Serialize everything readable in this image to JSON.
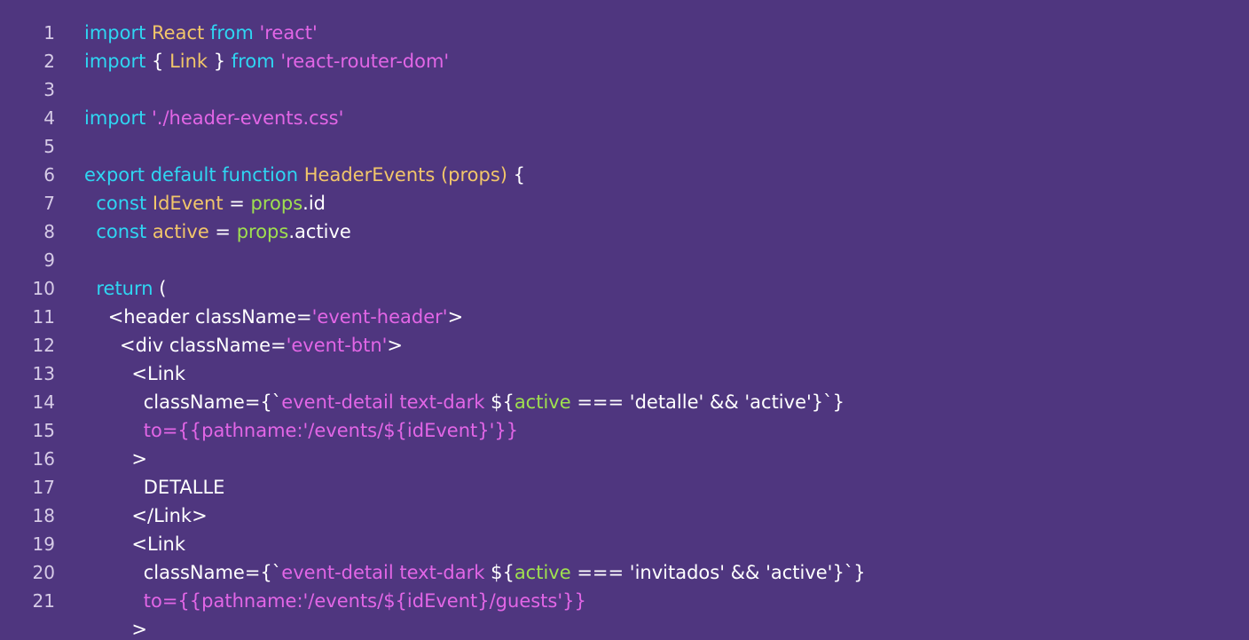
{
  "theme": {
    "background": "#4f367f",
    "keyword": "#2fd6f2",
    "identifier": "#f2c66a",
    "string": "#e266e6",
    "props": "#9fe04f",
    "plain": "#ffffff",
    "line_number": "#d6cbe6"
  },
  "lines": [
    {
      "n": "1",
      "tokens": [
        {
          "t": "import ",
          "c": "kw"
        },
        {
          "t": "React ",
          "c": "name"
        },
        {
          "t": "from ",
          "c": "kw"
        },
        {
          "t": "'react'",
          "c": "str"
        }
      ]
    },
    {
      "n": "2",
      "tokens": [
        {
          "t": "import ",
          "c": "kw"
        },
        {
          "t": "{ ",
          "c": "plain"
        },
        {
          "t": "Link",
          "c": "name"
        },
        {
          "t": " } ",
          "c": "plain"
        },
        {
          "t": "from ",
          "c": "kw"
        },
        {
          "t": "'react-router-dom'",
          "c": "str"
        }
      ]
    },
    {
      "n": "3",
      "tokens": []
    },
    {
      "n": "4",
      "tokens": [
        {
          "t": "import ",
          "c": "kw"
        },
        {
          "t": "'./header-events.css'",
          "c": "str"
        }
      ]
    },
    {
      "n": "5",
      "tokens": []
    },
    {
      "n": "6",
      "tokens": [
        {
          "t": "export default function ",
          "c": "kw"
        },
        {
          "t": "HeaderEvents (props)",
          "c": "name"
        },
        {
          "t": " {",
          "c": "plain"
        }
      ]
    },
    {
      "n": "7",
      "tokens": [
        {
          "t": "  const ",
          "c": "kw"
        },
        {
          "t": "IdEvent",
          "c": "name"
        },
        {
          "t": " = ",
          "c": "plain"
        },
        {
          "t": "props",
          "c": "prop"
        },
        {
          "t": ".id",
          "c": "plain"
        }
      ]
    },
    {
      "n": "8",
      "tokens": [
        {
          "t": "  const ",
          "c": "kw"
        },
        {
          "t": "active",
          "c": "name"
        },
        {
          "t": " = ",
          "c": "plain"
        },
        {
          "t": "props",
          "c": "prop"
        },
        {
          "t": ".active",
          "c": "plain"
        }
      ]
    },
    {
      "n": "9",
      "tokens": []
    },
    {
      "n": "10",
      "tokens": [
        {
          "t": "  return ",
          "c": "kw"
        },
        {
          "t": "(",
          "c": "plain"
        }
      ]
    },
    {
      "n": "11",
      "tokens": [
        {
          "t": "    <header className=",
          "c": "plain"
        },
        {
          "t": "'event-header'",
          "c": "str"
        },
        {
          "t": ">",
          "c": "plain"
        }
      ]
    },
    {
      "n": "12",
      "tokens": [
        {
          "t": "      <div className=",
          "c": "plain"
        },
        {
          "t": "'event-btn'",
          "c": "str"
        },
        {
          "t": ">",
          "c": "plain"
        }
      ]
    },
    {
      "n": "13",
      "tokens": [
        {
          "t": "        <Link",
          "c": "plain"
        }
      ]
    },
    {
      "n": "14",
      "tokens": [
        {
          "t": "          className={`",
          "c": "plain"
        },
        {
          "t": "event-detail text-dark ",
          "c": "str"
        },
        {
          "t": "${",
          "c": "plain"
        },
        {
          "t": "active",
          "c": "prop"
        },
        {
          "t": " === 'detalle' && 'active'}`}",
          "c": "plain"
        }
      ]
    },
    {
      "n": "15",
      "tokens": [
        {
          "t": "          to={{pathname:'/events/${idEvent}'}}",
          "c": "str"
        }
      ]
    },
    {
      "n": "16",
      "tokens": [
        {
          "t": "        >",
          "c": "plain"
        }
      ]
    },
    {
      "n": "17",
      "tokens": [
        {
          "t": "          DETALLE",
          "c": "plain"
        }
      ]
    },
    {
      "n": "18",
      "tokens": [
        {
          "t": "        </Link>",
          "c": "plain"
        }
      ]
    },
    {
      "n": "19",
      "tokens": [
        {
          "t": "        <Link",
          "c": "plain"
        }
      ]
    },
    {
      "n": "20",
      "tokens": [
        {
          "t": "          className={`",
          "c": "plain"
        },
        {
          "t": "event-detail text-dark ",
          "c": "str"
        },
        {
          "t": "${",
          "c": "plain"
        },
        {
          "t": "active",
          "c": "prop"
        },
        {
          "t": " === 'invitados' && 'active'}`}",
          "c": "plain"
        }
      ]
    },
    {
      "n": "21",
      "tokens": [
        {
          "t": "          to={{pathname:'/events/${idEvent}/guests'}}",
          "c": "str"
        }
      ]
    },
    {
      "n": "",
      "tokens": [
        {
          "t": "        >",
          "c": "plain"
        }
      ]
    }
  ]
}
